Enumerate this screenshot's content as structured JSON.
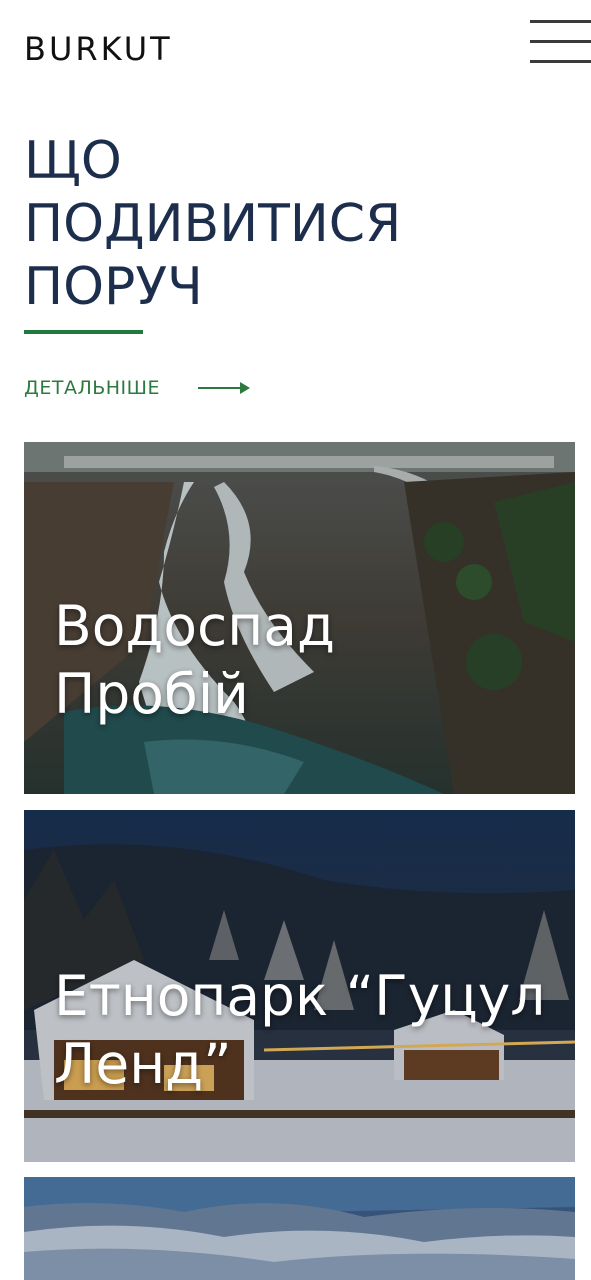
{
  "header": {
    "logo": "BURKUT",
    "menu_icon": "hamburger-menu-icon"
  },
  "section": {
    "title_lines": [
      "ЩО",
      "ПОДИВИТИСЯ",
      "ПОРУЧ"
    ],
    "more_label": "ДЕТАЛЬНІШЕ",
    "more_icon": "arrow-right-icon"
  },
  "cards": [
    {
      "title": "Водоспад\nПробій"
    },
    {
      "title": "Етнопарк “Гуцул\nЛенд”"
    },
    {
      "title": ""
    }
  ],
  "colors": {
    "title": "#1d2e4d",
    "accent_green": "#1f7a3c",
    "logo": "#111111"
  }
}
